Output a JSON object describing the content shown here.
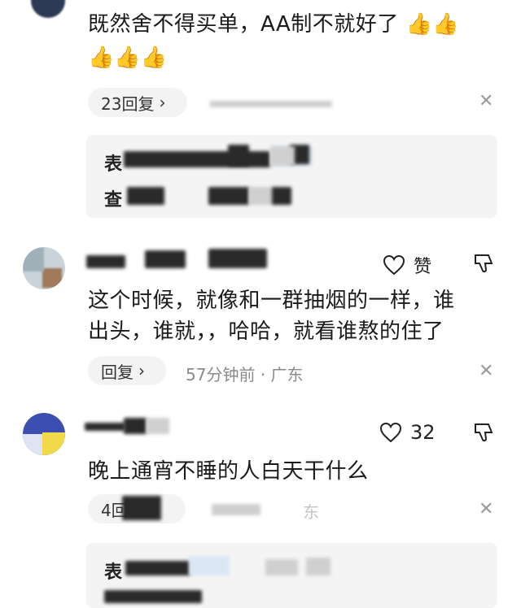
{
  "comments": [
    {
      "text_line1": "既然舍不得买单，AA制不就好了",
      "emoji_icon": "thumbs-up-emoji",
      "reply_label": "23回复",
      "sub_prefix1": "表",
      "sub_prefix2": "查"
    },
    {
      "text_line1": "这个时候，就像和一群抽烟的一样，谁",
      "text_line2": "出头，谁就，，哈哈，就看谁熬的住了",
      "like_label": "赞",
      "reply_label": "回复",
      "time": "57分钟前",
      "location": "广东"
    },
    {
      "like_count": "32",
      "text_line1": "晚上通宵不睡的人白天干什么",
      "reply_label": "4回",
      "location_tail": "东",
      "sub_prefix1": "表"
    }
  ],
  "icons": {
    "close": "close-icon",
    "heart": "heart-icon",
    "dislike": "thumbs-down-icon",
    "chevron": "chevron-right-icon"
  }
}
